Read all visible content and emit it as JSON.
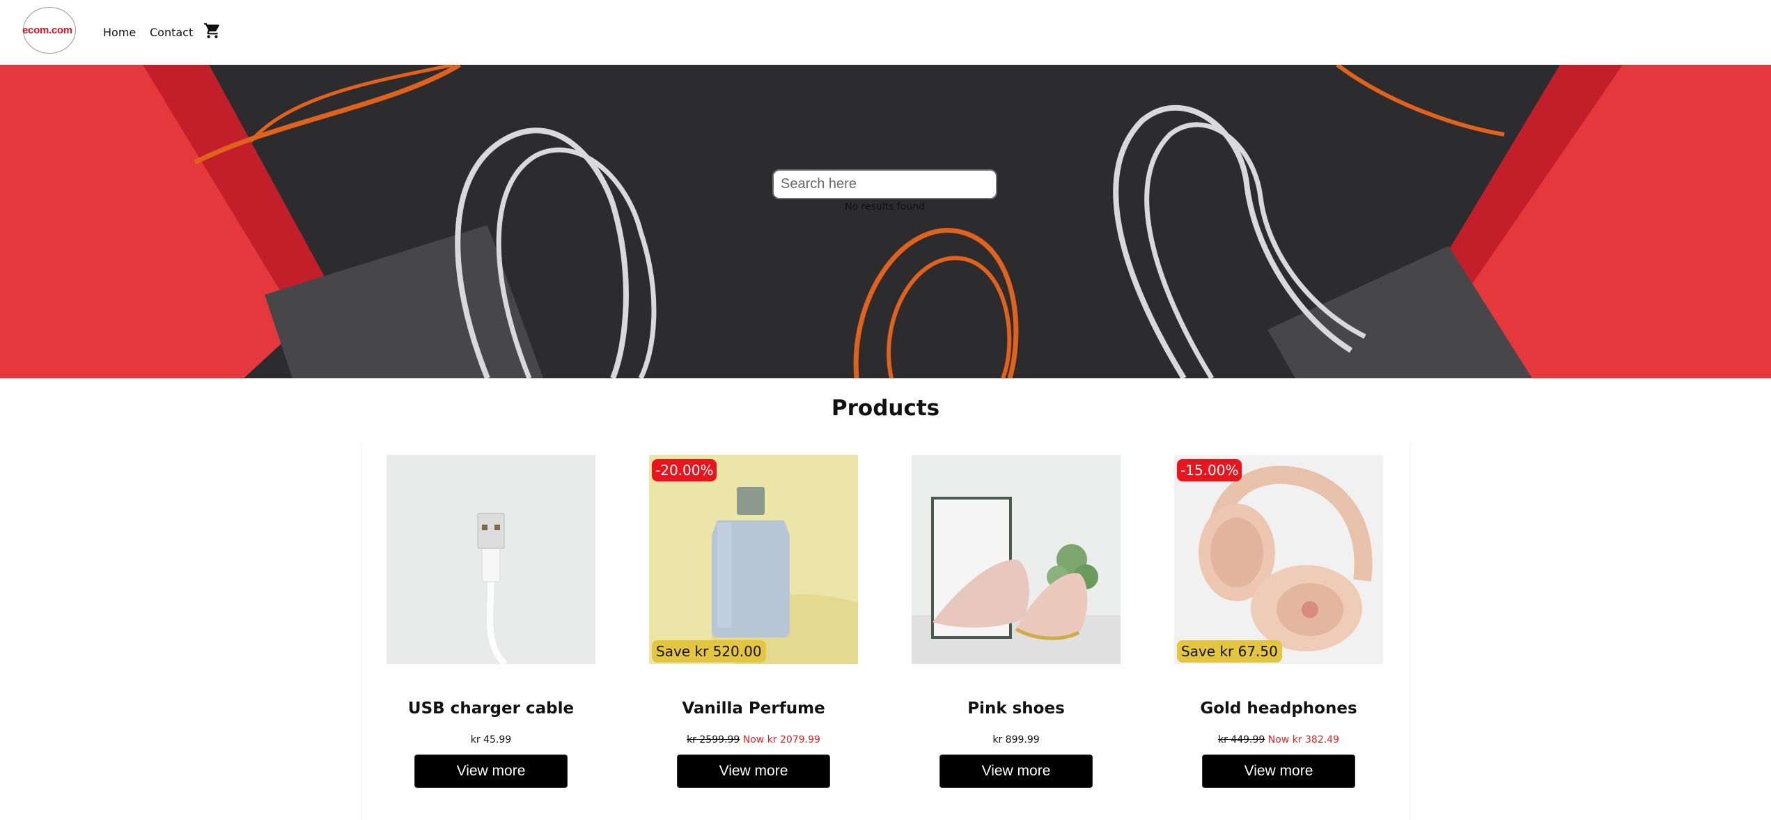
{
  "header": {
    "logo_text": "ecom.com",
    "nav": {
      "home": "Home",
      "contact": "Contact"
    },
    "cart_icon": "shopping-cart-icon"
  },
  "hero": {
    "search_placeholder": "Search here",
    "search_value": "",
    "status_text": "No results found"
  },
  "products": {
    "title": "Products",
    "items": [
      {
        "name": "USB charger cable",
        "price": "kr 45.99",
        "old_price": "",
        "now_price": "",
        "discount": "",
        "save": "",
        "button": "View more"
      },
      {
        "name": "Vanilla Perfume",
        "price": "",
        "old_price": "kr 2599.99",
        "now_price": "Now kr 2079.99",
        "discount": "-20.00%",
        "save": "Save kr 520.00",
        "button": "View more"
      },
      {
        "name": "Pink shoes",
        "price": "kr 899.99",
        "old_price": "",
        "now_price": "",
        "discount": "",
        "save": "",
        "button": "View more"
      },
      {
        "name": "Gold headphones",
        "price": "",
        "old_price": "kr 449.99",
        "now_price": "Now kr 382.49",
        "discount": "-15.00%",
        "save": "Save kr 67.50",
        "button": "View more"
      }
    ]
  },
  "colors": {
    "accent_red": "#e9141c",
    "save_yellow": "#e4c53f",
    "now_price_red": "#e52222",
    "button_black": "#000000"
  }
}
